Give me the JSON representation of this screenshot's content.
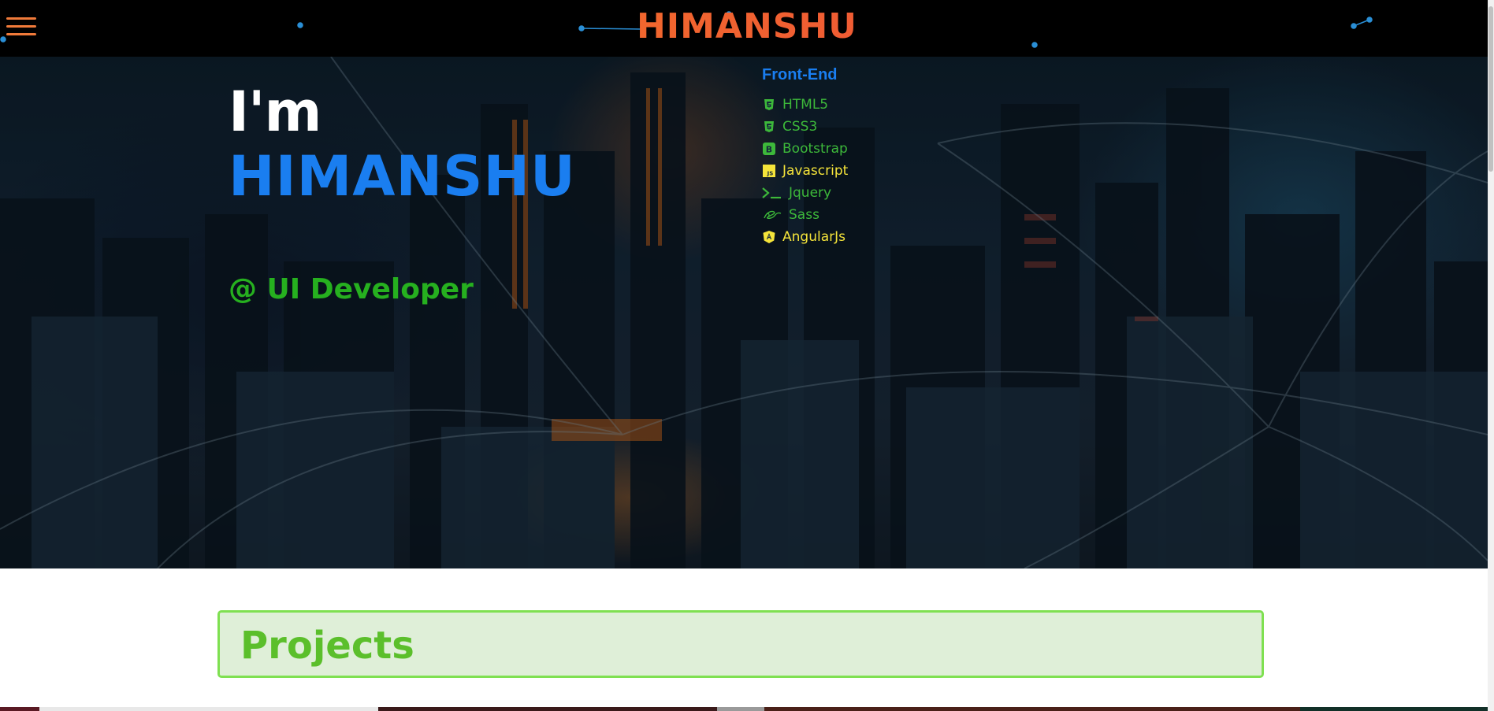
{
  "header": {
    "brand": "HIMANSHU",
    "menu_icon": "hamburger-menu-icon"
  },
  "hero": {
    "greeting": "I'm",
    "name": "HIMANSHU",
    "role": "@ UI Developer"
  },
  "skills": {
    "title": "Front-End",
    "items": [
      {
        "label": "HTML5",
        "icon": "html5-icon"
      },
      {
        "label": "CSS3",
        "icon": "css3-icon"
      },
      {
        "label": "Bootstrap",
        "icon": "bootstrap-icon"
      },
      {
        "label": "Javascript",
        "icon": "javascript-icon"
      },
      {
        "label": "Jquery",
        "icon": "terminal-icon"
      },
      {
        "label": "Sass",
        "icon": "sass-icon"
      },
      {
        "label": "AngularJs",
        "icon": "angular-icon"
      }
    ]
  },
  "projects": {
    "title": "Projects"
  },
  "colors": {
    "brand_gradient_start": "#f7851f",
    "brand_gradient_end": "#e23b4a",
    "name_blue": "#1a7ef0",
    "role_green": "#26b01f",
    "skill_green": "#3db83a",
    "skill_yellow": "#f5e43a",
    "projects_bg": "#dfefd8",
    "projects_border": "#7fe051"
  }
}
